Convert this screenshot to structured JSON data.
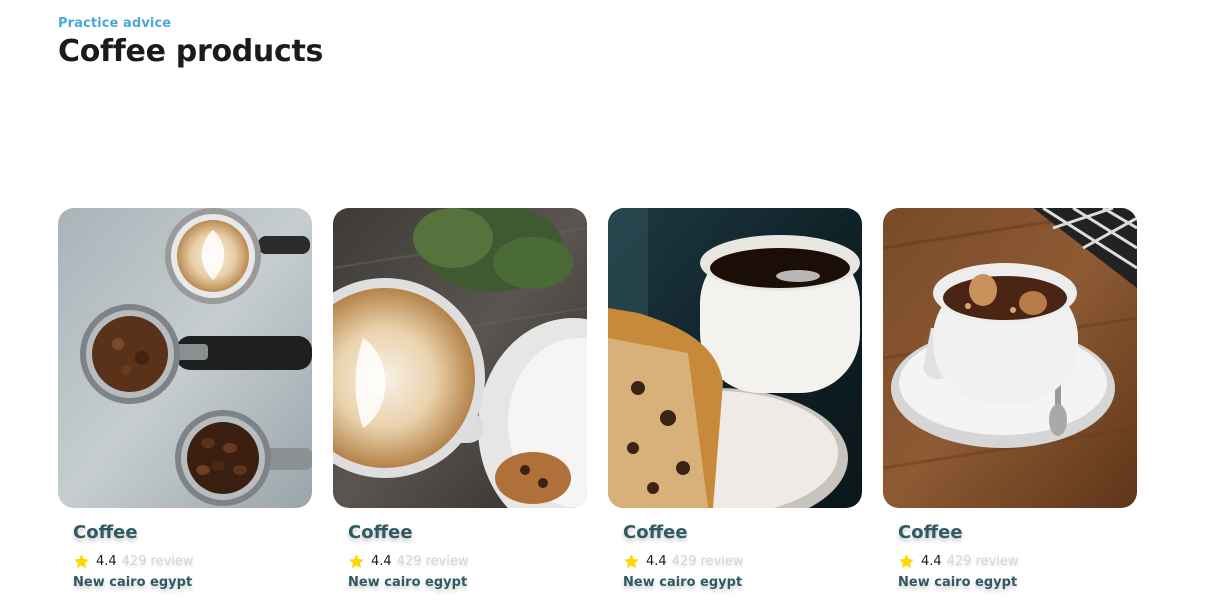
{
  "header": {
    "eyebrow": "Practice advice",
    "title": "Coffee products"
  },
  "products": [
    {
      "title": "Coffee",
      "rating": "4.4",
      "review_count": "429",
      "review_label": "review",
      "location": "New cairo egypt",
      "photo": "espresso-portafilters-latte"
    },
    {
      "title": "Coffee",
      "rating": "4.4",
      "review_count": "429",
      "review_label": "review",
      "location": "New cairo egypt",
      "photo": "latte-art-cookie"
    },
    {
      "title": "Coffee",
      "rating": "4.4",
      "review_count": "429",
      "review_label": "review",
      "location": "New cairo egypt",
      "photo": "black-coffee-cake"
    },
    {
      "title": "Coffee",
      "rating": "4.4",
      "review_count": "429",
      "review_label": "review",
      "location": "New cairo egypt",
      "photo": "cocoa-cup-saucer"
    }
  ],
  "colors": {
    "eyebrow": "#4aa8d8",
    "card_title": "#2f5a63",
    "star": "#ffd600",
    "muted": "#d4d4d4"
  },
  "icons": {
    "rating": "star-icon"
  }
}
